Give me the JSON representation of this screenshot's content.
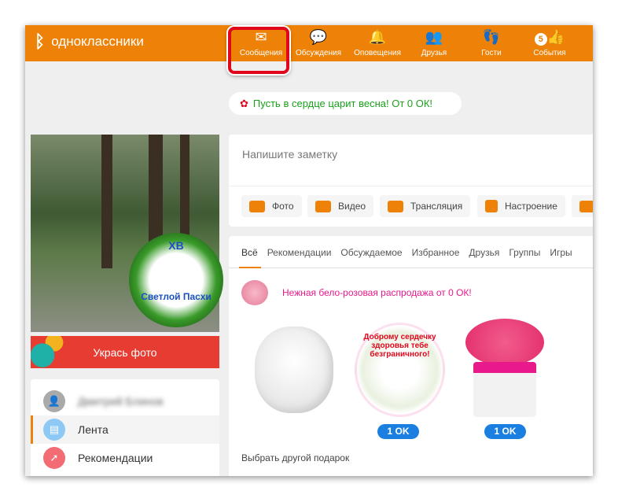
{
  "header": {
    "logo": "одноклассники",
    "nav": [
      {
        "label": "Сообщения",
        "icon": "envelope-icon"
      },
      {
        "label": "Обсуждения",
        "icon": "chat-bubbles-icon"
      },
      {
        "label": "Оповещения",
        "icon": "bell-icon"
      },
      {
        "label": "Друзья",
        "icon": "friends-icon"
      },
      {
        "label": "Гости",
        "icon": "footprints-icon"
      },
      {
        "label": "События",
        "icon": "events-like-icon",
        "badge": "5"
      }
    ]
  },
  "promo": "Пусть в сердце царит весна! От 0 ОК!",
  "profile": {
    "photo_caption_top": "ХВ",
    "photo_caption_bottom": "Светлой Пасхи",
    "decorate_button": "Укрась фото"
  },
  "menu": [
    {
      "label": "Дмитрий Блинов",
      "color": "#aaaaaa"
    },
    {
      "label": "Лента",
      "color": "#8ec9f5"
    },
    {
      "label": "Рекомендации",
      "color": "#f36c74"
    }
  ],
  "note": {
    "placeholder": "Напишите заметку",
    "actions": [
      "Фото",
      "Видео",
      "Трансляция",
      "Настроение"
    ]
  },
  "feed": {
    "tabs": [
      "Всё",
      "Рекомендации",
      "Обсуждаемое",
      "Избранное",
      "Друзья",
      "Группы",
      "Игры"
    ],
    "sale": "Нежная бело-розовая распродажа от 0 ОК!",
    "gift_text": "Доброму сердечку здоровья тебе безграничного!",
    "price": "1 OK",
    "other_gift": "Выбрать другой подарок"
  },
  "colors": {
    "accent": "#ee8208",
    "promo_text": "#1ba01b",
    "sale_text": "#e8198b",
    "ok_button": "#1a7fe0",
    "highlight": "#e0061b"
  }
}
